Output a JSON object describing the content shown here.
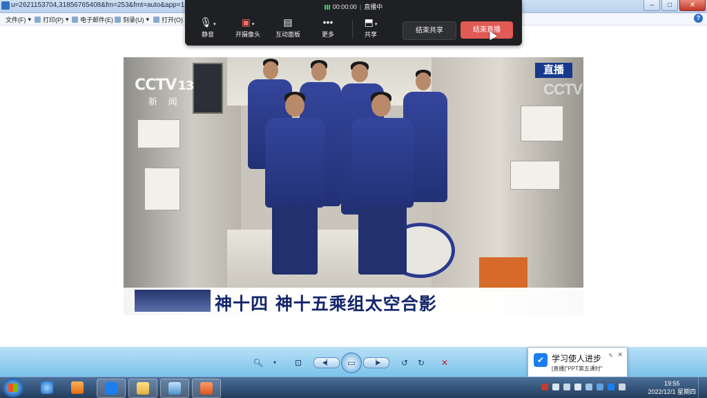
{
  "window": {
    "url": "u=2621153704,31856765408&fm=253&fmt=auto&app=1...",
    "buttons": [
      "–",
      "□",
      "✕"
    ]
  },
  "menubar": {
    "items": [
      "文件(F)",
      "打印(P)",
      "电子邮件(E)",
      "刻录(U)",
      "打开(O)"
    ],
    "help": "?"
  },
  "meeting": {
    "timer": "00:00:00",
    "status": "直播中",
    "tools": [
      {
        "label": "静音",
        "icon": "microphone-icon"
      },
      {
        "label": "开摄像头",
        "icon": "camera-off-icon"
      },
      {
        "label": "互动面板",
        "icon": "chat-panel-icon"
      },
      {
        "label": "更多",
        "icon": "more-icon"
      },
      {
        "label": "共享",
        "icon": "share-screen-icon"
      }
    ],
    "stop_share": "结束共享",
    "end_live": "结束直播"
  },
  "video": {
    "channel_logo": "CCTV",
    "channel_number": "13",
    "channel_name": "新 闻",
    "live_badge": "直播",
    "caption": "神十四 神十五乘组太空合影"
  },
  "player": {
    "controls": [
      "zoom-icon",
      "fit-icon",
      "prev-icon",
      "play-icon",
      "next-icon",
      "rotate-left-icon",
      "rotate-right-icon",
      "close-icon"
    ]
  },
  "notification": {
    "title": "学习使人进步",
    "body": "[直播]\"PPT第五课时\""
  },
  "taskbar": {
    "time": "19:55",
    "date": "2022/12/1 星期四"
  },
  "colors": {
    "end_live": "#e25a55",
    "live_badge": "#16388d",
    "caption_text": "#13256b"
  }
}
